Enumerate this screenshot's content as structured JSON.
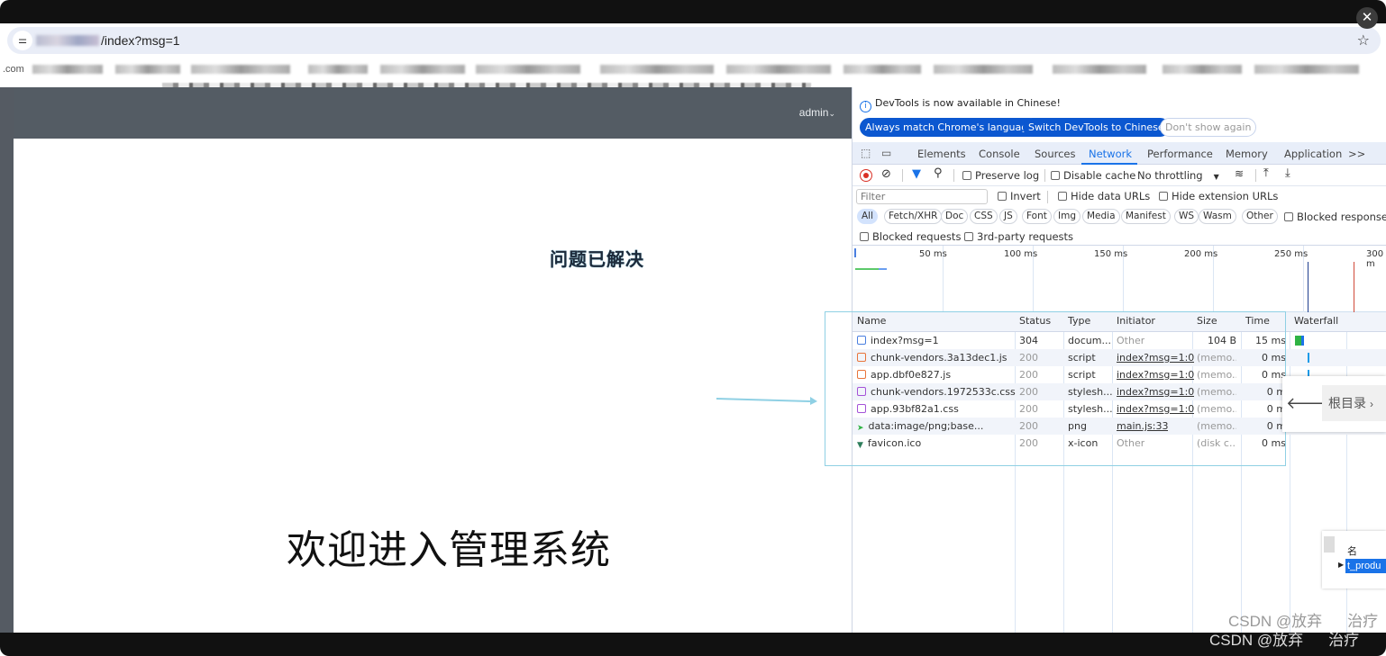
{
  "browser": {
    "url_visible": "/index?msg=1",
    "bookmark_first": ".com"
  },
  "app": {
    "user_menu": "admin",
    "annotation": "问题已解决",
    "welcome": "欢迎进入管理系统"
  },
  "devtools": {
    "notice": "DevTools is now available in Chinese!",
    "notice_buttons": [
      "Always match Chrome's language",
      "Switch DevTools to Chinese",
      "Don't show again"
    ],
    "tabs": [
      "Elements",
      "Console",
      "Sources",
      "Network",
      "Performance",
      "Memory",
      "Application"
    ],
    "active_tab": "Network",
    "more_tabs": ">>",
    "toolbar": {
      "preserve_log": "Preserve log",
      "disable_cache": "Disable cache",
      "throttling": "No throttling"
    },
    "filter": {
      "placeholder": "Filter",
      "invert": "Invert",
      "hide_data_urls": "Hide data URLs",
      "hide_extension_urls": "Hide extension URLs"
    },
    "type_filters": [
      "All",
      "Fetch/XHR",
      "Doc",
      "CSS",
      "JS",
      "Font",
      "Img",
      "Media",
      "Manifest",
      "WS",
      "Wasm",
      "Other"
    ],
    "blocked_response": "Blocked response co",
    "blocked_requests": "Blocked requests",
    "third_party": "3rd-party requests",
    "timeline_ticks": [
      "50 ms",
      "100 ms",
      "150 ms",
      "200 ms",
      "250 ms",
      "300 m"
    ],
    "columns": [
      "Name",
      "Status",
      "Type",
      "Initiator",
      "Size",
      "Time",
      "Waterfall"
    ],
    "rows": [
      {
        "name": "index?msg=1",
        "status": "304",
        "type": "docum...",
        "initiator": "Other",
        "size": "104 B",
        "time": "15 ms",
        "icon": "document-icon",
        "color": "#4a7fe0"
      },
      {
        "name": "chunk-vendors.3a13dec1.js",
        "status": "200",
        "type": "script",
        "initiator": "index?msg=1:0",
        "size": "(memo...",
        "time": "0 ms",
        "icon": "script-icon",
        "color": "#e8743b"
      },
      {
        "name": "app.dbf0e827.js",
        "status": "200",
        "type": "script",
        "initiator": "index?msg=1:0",
        "size": "(memo...",
        "time": "0 ms",
        "icon": "script-icon",
        "color": "#e8743b"
      },
      {
        "name": "chunk-vendors.1972533c.css",
        "status": "200",
        "type": "stylesh...",
        "initiator": "index?msg=1:0",
        "size": "(memo...",
        "time": "0 m",
        "icon": "stylesheet-icon",
        "color": "#a452d8"
      },
      {
        "name": "app.93bf82a1.css",
        "status": "200",
        "type": "stylesh...",
        "initiator": "index?msg=1:0",
        "size": "(memo...",
        "time": "0 m",
        "icon": "stylesheet-icon",
        "color": "#a452d8"
      },
      {
        "name": "data:image/png;base...",
        "status": "200",
        "type": "png",
        "initiator": "main.js:33",
        "size": "(memo...",
        "time": "0 m",
        "icon": "image-icon",
        "color": "#2fb344"
      },
      {
        "name": "favicon.ico",
        "status": "200",
        "type": "x-icon",
        "initiator": "Other",
        "size": "(disk c...",
        "time": "0 ms",
        "icon": "favicon-icon",
        "color": "#2e7d5b"
      }
    ]
  },
  "overlay": {
    "popup_label": "根目录",
    "mini_header": "名",
    "mini_selected": "t_produ"
  },
  "watermark": {
    "text1": "CSDN @放弃",
    "text2": "治疗"
  }
}
